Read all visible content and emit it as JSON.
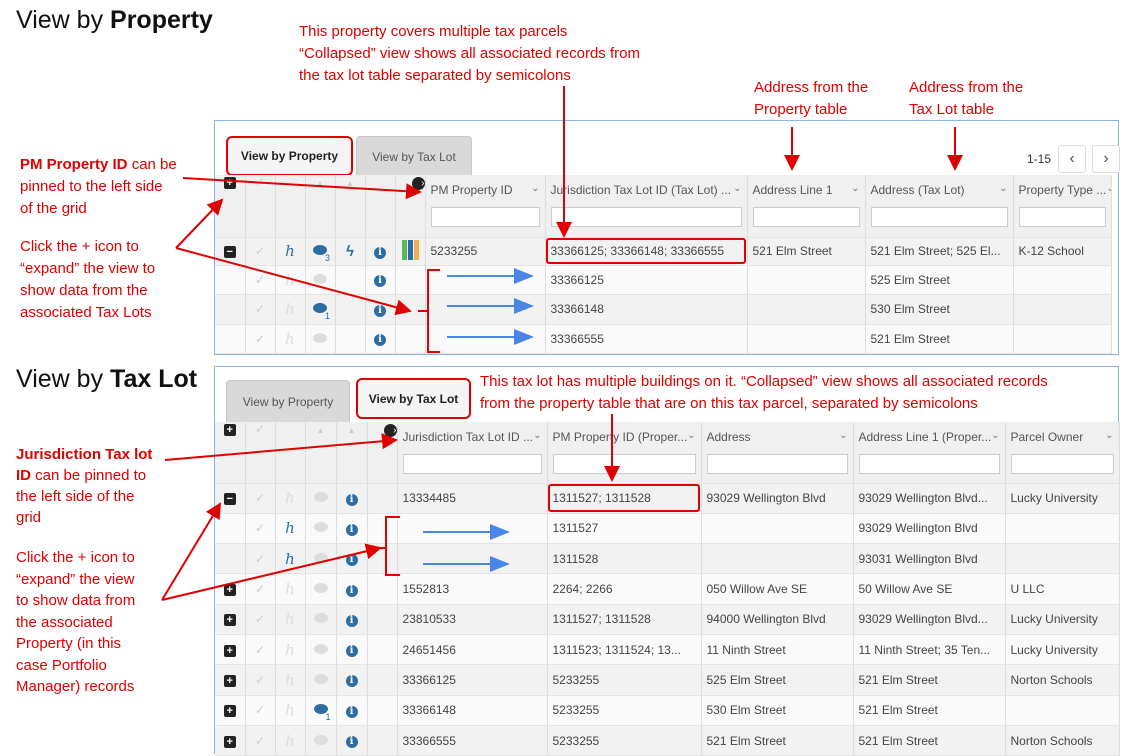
{
  "section1": {
    "title_pre": "View by ",
    "title_bold": "Property"
  },
  "section2": {
    "title_pre": "View by ",
    "title_bold": "Tax Lot"
  },
  "annotations": {
    "multi_parcel": "This property covers multiple tax parcels\n“Collapsed” view shows all associated records from\nthe tax lot table separated by semicolons",
    "addr_property": "Address from the\nProperty table",
    "addr_taxlot": "Address from the\nTax Lot table",
    "pin_prop_bold": "PM Property ID",
    "pin_prop_rest": " can be\npinned to the left side\nof the grid",
    "expand_prop": "Click the + icon to\n“expand” the view to\nshow data from the\nassociated Tax Lots",
    "multi_building": "This tax lot has multiple buildings on it. “Collapsed” view shows all associated records\nfrom the property table that are on this tax parcel, separated by semicolons",
    "pin_tax_bold": "Jurisdiction Tax lot\nID",
    "pin_tax_rest": " can be pinned to\nthe left side of the\ngrid",
    "expand_tax": "Click the + icon to\n“expand” the view\nto show data from\nthe associated\nProperty (in this\ncase Portfolio\nManager) records"
  },
  "tabs": {
    "by_property": "View by Property",
    "by_taxlot": "View by Tax Lot"
  },
  "pager": {
    "range": "1-15",
    "prev": "‹",
    "next": "›"
  },
  "colors": {
    "annotation": "#e00000",
    "arrow_blue": "#4a86e8",
    "icon_blue": "#2e6da4",
    "bar_colors": [
      "#5cb85c",
      "#2e6da4",
      "#f0ad4e"
    ]
  },
  "property_grid": {
    "columns": [
      "PM Property ID",
      "Jurisdiction Tax Lot ID (Tax Lot) ...",
      "Address Line 1",
      "Address (Tax Lot)",
      "Property Type ..."
    ],
    "rows": [
      {
        "expand": "minus",
        "h": "blue",
        "comment": "blue",
        "comment_count": "3",
        "bolt": true,
        "bars": true,
        "cells": [
          "5233255",
          "33366125; 33366148; 33366555",
          "521 Elm Street",
          "521 Elm Street; 525 El...",
          "K-12 School"
        ]
      },
      {
        "expand": "",
        "h": "faded",
        "comment": "faded",
        "comment_count": "",
        "bolt": false,
        "bars": false,
        "cells": [
          "",
          "33366125",
          "",
          "525 Elm Street",
          ""
        ]
      },
      {
        "expand": "",
        "h": "faded",
        "comment": "blue",
        "comment_count": "1",
        "bolt": false,
        "bars": false,
        "cells": [
          "",
          "33366148",
          "",
          "530 Elm Street",
          ""
        ]
      },
      {
        "expand": "",
        "h": "faded",
        "comment": "faded",
        "comment_count": "",
        "bolt": false,
        "bars": false,
        "cells": [
          "",
          "33366555",
          "",
          "521 Elm Street",
          ""
        ]
      }
    ]
  },
  "taxlot_grid": {
    "columns": [
      "Jurisdiction Tax Lot ID ...",
      "PM Property ID (Proper...",
      "Address",
      "Address Line 1 (Proper...",
      "Parcel Owner"
    ],
    "rows": [
      {
        "expand": "minus",
        "h": "faded",
        "comment": "faded",
        "comment_count": "",
        "cells": [
          "13334485",
          "1311527; 1311528",
          "93029 Wellington Blvd",
          "93029 Wellington Blvd...",
          "Lucky University"
        ]
      },
      {
        "expand": "",
        "h": "blue",
        "comment": "faded",
        "comment_count": "",
        "cells": [
          "",
          "1311527",
          "",
          "93029 Wellington Blvd",
          ""
        ]
      },
      {
        "expand": "",
        "h": "blue",
        "comment": "faded",
        "comment_count": "",
        "cells": [
          "",
          "1311528",
          "",
          "93031 Wellington Blvd",
          ""
        ]
      },
      {
        "expand": "plus",
        "h": "faded",
        "comment": "faded",
        "comment_count": "",
        "cells": [
          "1552813",
          "2264; 2266",
          "050 Willow Ave SE",
          "50 Willow Ave SE",
          "U LLC"
        ]
      },
      {
        "expand": "plus",
        "h": "faded",
        "comment": "faded",
        "comment_count": "",
        "cells": [
          "23810533",
          "1311527; 1311528",
          "94000 Wellington Blvd",
          "93029 Wellington Blvd...",
          "Lucky University"
        ]
      },
      {
        "expand": "plus",
        "h": "faded",
        "comment": "faded",
        "comment_count": "",
        "cells": [
          "24651456",
          "1311523; 1311524; 13...",
          "11 Ninth Street",
          "11 Ninth Street; 35 Ten...",
          "Lucky University"
        ]
      },
      {
        "expand": "plus",
        "h": "faded",
        "comment": "faded",
        "comment_count": "",
        "cells": [
          "33366125",
          "5233255",
          "525 Elm Street",
          "521 Elm Street",
          "Norton Schools"
        ]
      },
      {
        "expand": "plus",
        "h": "faded",
        "comment": "blue",
        "comment_count": "1",
        "cells": [
          "33366148",
          "5233255",
          "530 Elm Street",
          "521 Elm Street",
          ""
        ]
      },
      {
        "expand": "plus",
        "h": "faded",
        "comment": "faded",
        "comment_count": "",
        "cells": [
          "33366555",
          "5233255",
          "521 Elm Street",
          "521 Elm Street",
          "Norton Schools"
        ]
      }
    ]
  }
}
